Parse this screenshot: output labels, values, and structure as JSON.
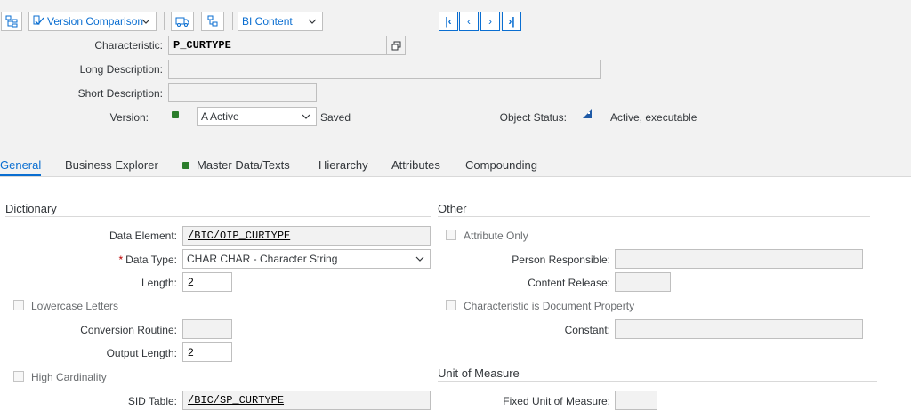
{
  "toolbar": {
    "version_comparison": "Version Comparison",
    "bi_content": "BI Content"
  },
  "header": {
    "characteristic_label": "Characteristic:",
    "characteristic_value": "P_CURTYPE",
    "long_desc_label": "Long Description:",
    "long_desc_value": "",
    "short_desc_label": "Short Description:",
    "short_desc_value": "",
    "version_label": "Version:",
    "version_value": "A Active",
    "version_state": "Saved",
    "object_status_label": "Object Status:",
    "object_status_value": "Active, executable"
  },
  "tabs": [
    {
      "label": "General"
    },
    {
      "label": "Business Explorer"
    },
    {
      "label": "Master Data/Texts"
    },
    {
      "label": "Hierarchy"
    },
    {
      "label": "Attributes"
    },
    {
      "label": "Compounding"
    }
  ],
  "dictionary": {
    "title": "Dictionary",
    "data_element_label": "Data Element:",
    "data_element_value": "/BIC/OIP_CURTYPE",
    "data_type_label": "Data Type:",
    "data_type_value": "CHAR CHAR - Character String",
    "length_label": "Length:",
    "length_value": "2",
    "lowercase_label": "Lowercase Letters",
    "conversion_label": "Conversion Routine:",
    "conversion_value": "",
    "output_length_label": "Output Length:",
    "output_length_value": "2",
    "high_card_label": "High Cardinality",
    "sid_table_label": "SID Table:",
    "sid_table_value": "/BIC/SP_CURTYPE"
  },
  "other": {
    "title": "Other",
    "attribute_only_label": "Attribute Only",
    "person_label": "Person Responsible:",
    "person_value": "",
    "content_release_label": "Content Release:",
    "content_release_value": "",
    "doc_property_label": "Characteristic is Document Property",
    "constant_label": "Constant:",
    "constant_value": ""
  },
  "uom": {
    "title": "Unit of Measure",
    "fixed_label": "Fixed Unit of Measure:",
    "fixed_value": ""
  },
  "colors": {
    "accent": "#0a6ed1",
    "active_green": "#2b7d2b"
  }
}
